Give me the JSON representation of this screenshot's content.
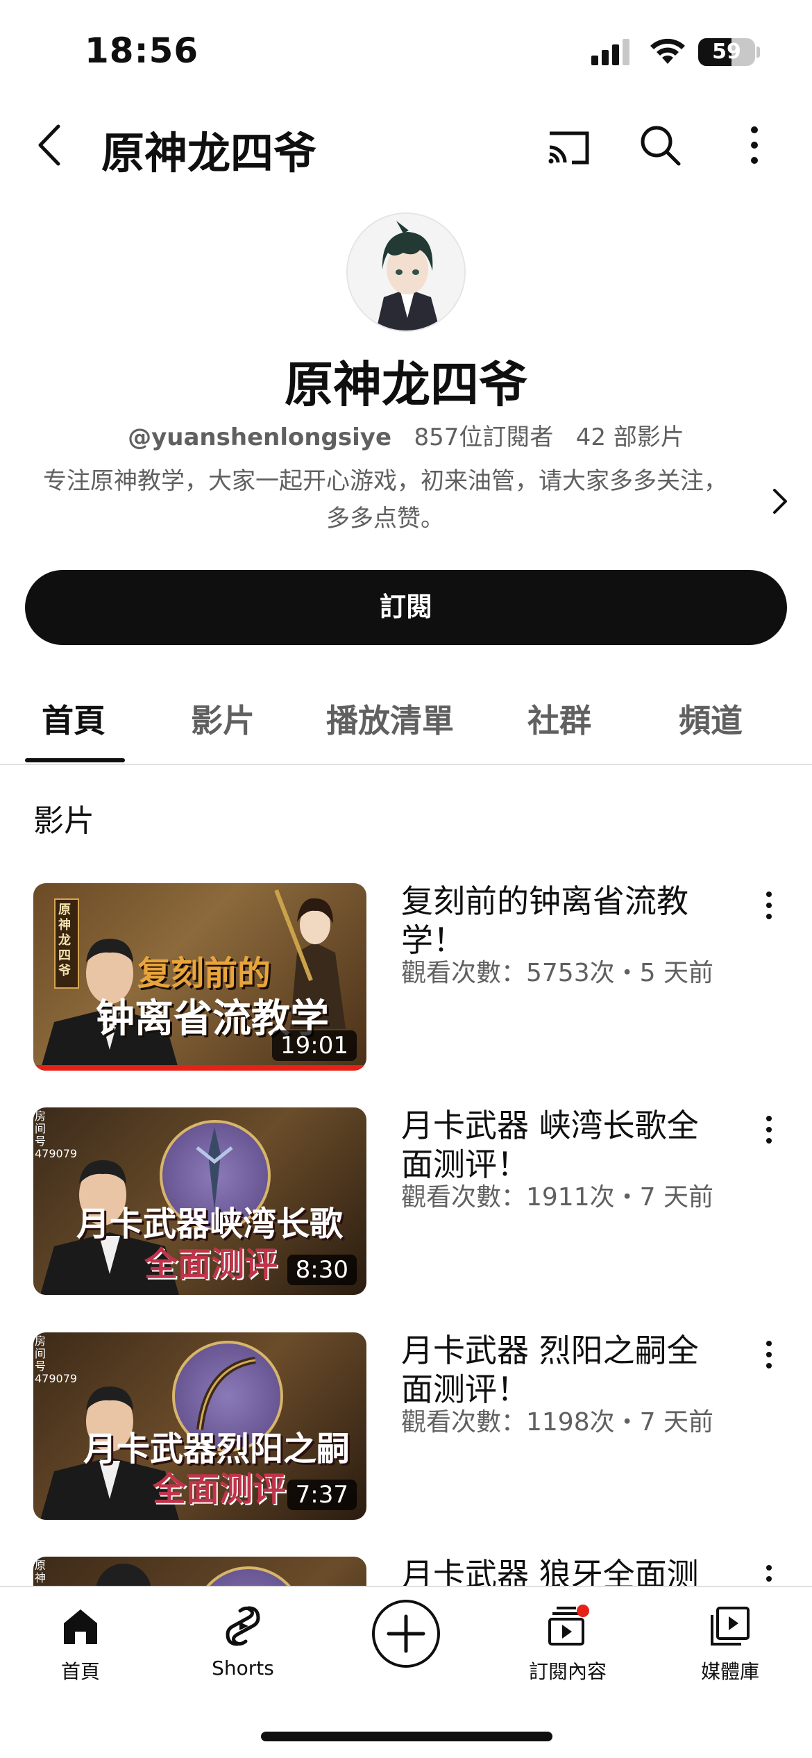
{
  "status_bar": {
    "time": "18:56",
    "battery": "59"
  },
  "header": {
    "title": "原神龙四爷"
  },
  "channel": {
    "name": "原神龙四爷",
    "handle": "@yuanshenlongsiye",
    "subscribers": "857位訂閱者",
    "videos": "42 部影片",
    "description": "专注原神教学，大家一起开心游戏，初来油管，请大家多多关注，多多点赞。"
  },
  "subscribe_label": "訂閱",
  "tabs": [
    {
      "label": "首頁",
      "active": true
    },
    {
      "label": "影片"
    },
    {
      "label": "播放清單"
    },
    {
      "label": "社群"
    },
    {
      "label": "頻道"
    }
  ],
  "section_title": "影片",
  "videos": [
    {
      "title": "复刻前的钟离省流教学！",
      "meta": "觀看次數：5753次・5 天前",
      "duration": "19:01",
      "thumb_line1": "复刻前的",
      "thumb_line2": "钟离省流教学",
      "side_text": "原神 龙四爷"
    },
    {
      "title": "月卡武器 峡湾长歌全面测评！",
      "meta": "觀看次數：1911次・7 天前",
      "duration": "8:30",
      "thumb_line1": "月卡武器峡湾长歌",
      "thumb_line2": "全面测评",
      "side_text": "房间号 479079"
    },
    {
      "title": "月卡武器 烈阳之嗣全面测评！",
      "meta": "觀看次數：1198次・7 天前",
      "duration": "7:37",
      "thumb_line1": "月卡武器烈阳之嗣",
      "thumb_line2": "全面测评",
      "side_text": "房间号 479079"
    },
    {
      "title": "月卡武器 狼牙全面测",
      "meta": "",
      "duration": "",
      "thumb_line1": "",
      "thumb_line2": "",
      "side_text": "原神"
    }
  ],
  "bottom_nav": [
    {
      "label": "首頁",
      "icon": "home-icon"
    },
    {
      "label": "Shorts",
      "icon": "shorts-icon"
    },
    {
      "label": "",
      "icon": "create-icon"
    },
    {
      "label": "訂閱內容",
      "icon": "subscriptions-icon"
    },
    {
      "label": "媒體庫",
      "icon": "library-icon"
    }
  ],
  "colors": {
    "accent": "#0f0f0f",
    "progress": "#e62117",
    "notification_dot": "#e62117",
    "muted_text": "#606060"
  }
}
